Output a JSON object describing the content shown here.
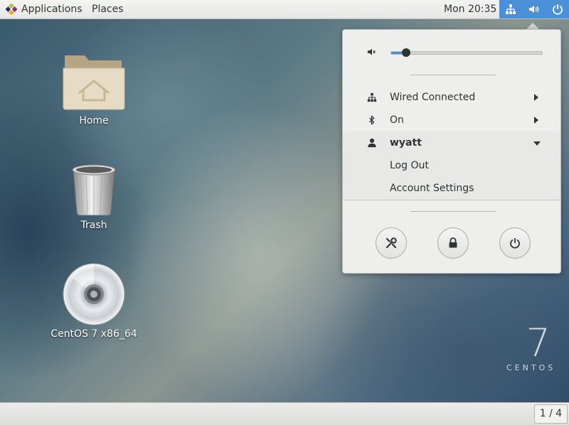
{
  "topbar": {
    "applications_label": "Applications",
    "places_label": "Places",
    "clock": "Mon 20:35"
  },
  "desktop": {
    "icons": [
      {
        "label": "Home",
        "icon": "home-folder-icon"
      },
      {
        "label": "Trash",
        "icon": "trash-icon"
      },
      {
        "label": "CentOS 7 x86_64",
        "icon": "disc-icon"
      }
    ],
    "watermark": {
      "number": "7",
      "word": "CENTOS"
    }
  },
  "system_menu": {
    "volume": {
      "icon": "volume-muted-icon",
      "level": 0.1
    },
    "wired": {
      "label": "Wired Connected",
      "icon": "network-icon"
    },
    "bluetooth": {
      "label": "On",
      "icon": "bluetooth-icon"
    },
    "user": {
      "name": "wyatt",
      "icon": "user-icon"
    },
    "log_out": "Log Out",
    "account_settings": "Account Settings",
    "actions": [
      "settings-icon",
      "lock-icon",
      "power-icon"
    ]
  },
  "bottombar": {
    "workspace": "1 / 4"
  },
  "colors": {
    "accent": "#4a90d9",
    "panel_bg": "#eeeeec"
  }
}
